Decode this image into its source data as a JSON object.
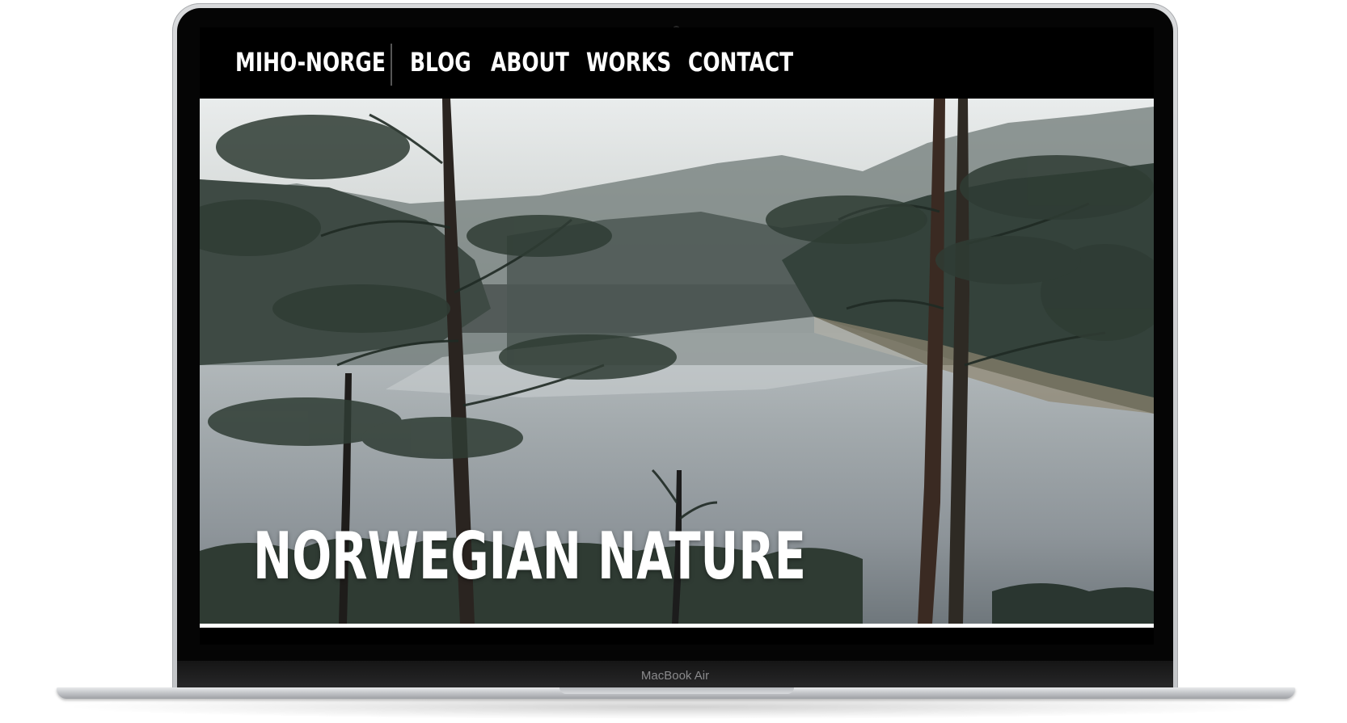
{
  "nav": {
    "brand": "MIHO-NORGE",
    "items": [
      {
        "label": "BLOG"
      },
      {
        "label": "ABOUT"
      },
      {
        "label": "WORKS"
      },
      {
        "label": "CONTACT"
      }
    ]
  },
  "hero": {
    "title": "NORWEGIAN NATURE",
    "image_subject": "forest-lake-landscape"
  },
  "device": {
    "label": "MacBook Air"
  },
  "colors": {
    "nav_background": "#000000",
    "nav_text": "#ffffff",
    "hero_title": "#ffffff"
  }
}
